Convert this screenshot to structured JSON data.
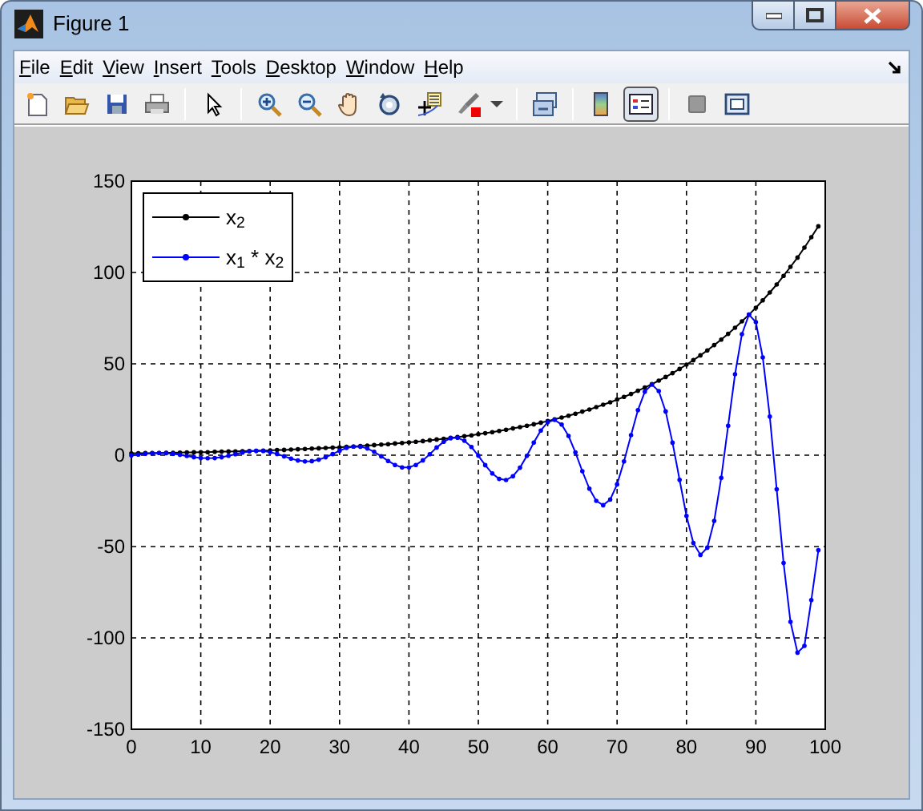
{
  "window": {
    "title": "Figure 1"
  },
  "menu": [
    {
      "label": "File"
    },
    {
      "label": "Edit"
    },
    {
      "label": "View"
    },
    {
      "label": "Insert"
    },
    {
      "label": "Tools"
    },
    {
      "label": "Desktop"
    },
    {
      "label": "Window"
    },
    {
      "label": "Help"
    }
  ],
  "toolbar": [
    {
      "kind": "new",
      "pressed": false
    },
    {
      "kind": "open",
      "pressed": false
    },
    {
      "kind": "save",
      "pressed": false
    },
    {
      "kind": "print",
      "pressed": false
    },
    {
      "kind": "separator"
    },
    {
      "kind": "pointer",
      "pressed": false
    },
    {
      "kind": "separator"
    },
    {
      "kind": "zoom-in",
      "pressed": false
    },
    {
      "kind": "zoom-out",
      "pressed": false
    },
    {
      "kind": "pan",
      "pressed": false
    },
    {
      "kind": "rotate",
      "pressed": false
    },
    {
      "kind": "data-cursor",
      "pressed": false
    },
    {
      "kind": "brush",
      "pressed": false
    },
    {
      "kind": "dropdown"
    },
    {
      "kind": "separator"
    },
    {
      "kind": "link",
      "pressed": false
    },
    {
      "kind": "separator"
    },
    {
      "kind": "colorbar",
      "pressed": false
    },
    {
      "kind": "legend",
      "pressed": true
    },
    {
      "kind": "separator"
    },
    {
      "kind": "hide-tools",
      "pressed": false
    },
    {
      "kind": "show-tools",
      "pressed": false
    }
  ],
  "chart_data": {
    "type": "line",
    "grid": true,
    "xlim": [
      0,
      100
    ],
    "ylim": [
      -150,
      150
    ],
    "xticks": [
      0,
      10,
      20,
      30,
      40,
      50,
      60,
      70,
      80,
      90,
      100
    ],
    "yticks": [
      -150,
      -100,
      -50,
      0,
      50,
      100,
      150
    ],
    "x": [
      0,
      1,
      2,
      3,
      4,
      5,
      6,
      7,
      8,
      9,
      10,
      11,
      12,
      13,
      14,
      15,
      16,
      17,
      18,
      19,
      20,
      21,
      22,
      23,
      24,
      25,
      26,
      27,
      28,
      29,
      30,
      31,
      32,
      33,
      34,
      35,
      36,
      37,
      38,
      39,
      40,
      41,
      42,
      43,
      44,
      45,
      46,
      47,
      48,
      49,
      50,
      51,
      52,
      53,
      54,
      55,
      56,
      57,
      58,
      59,
      60,
      61,
      62,
      63,
      64,
      65,
      66,
      67,
      68,
      69,
      70,
      71,
      72,
      73,
      74,
      75,
      76,
      77,
      78,
      79,
      80,
      81,
      82,
      83,
      84,
      85,
      86,
      87,
      88,
      89,
      90,
      91,
      92,
      93,
      94,
      95,
      96,
      97,
      98,
      99
    ],
    "series": [
      {
        "name": "x$_{2}$",
        "color": "#000000",
        "values": [
          1.0,
          1.05,
          1.1,
          1.16,
          1.22,
          1.28,
          1.34,
          1.41,
          1.48,
          1.55,
          1.63,
          1.71,
          1.8,
          1.89,
          1.98,
          2.08,
          2.18,
          2.29,
          2.41,
          2.53,
          2.65,
          2.79,
          2.93,
          3.07,
          3.23,
          3.39,
          3.56,
          3.73,
          3.92,
          4.12,
          4.32,
          4.54,
          4.76,
          5.0,
          5.25,
          5.52,
          5.79,
          6.08,
          6.39,
          6.7,
          7.04,
          7.39,
          7.76,
          8.15,
          8.56,
          8.99,
          9.43,
          9.91,
          10.4,
          10.92,
          11.47,
          12.04,
          12.64,
          13.27,
          13.94,
          14.64,
          15.37,
          16.14,
          16.94,
          17.79,
          18.68,
          19.61,
          20.59,
          21.62,
          22.7,
          23.84,
          25.03,
          26.28,
          27.6,
          28.98,
          30.43,
          31.95,
          33.55,
          35.22,
          36.98,
          38.83,
          40.78,
          42.81,
          44.95,
          47.2,
          49.56,
          52.04,
          54.64,
          57.37,
          60.24,
          63.25,
          66.42,
          69.74,
          73.23,
          76.89,
          80.73,
          84.77,
          89.01,
          93.46,
          98.13,
          103.04,
          108.19,
          113.6,
          119.28,
          125.24
        ]
      },
      {
        "name": "x$_{1}$ * x$_{2}$",
        "color": "#0000ff",
        "values": [
          -0.1,
          0.34,
          0.77,
          1.09,
          1.22,
          1.1,
          0.75,
          0.22,
          -0.42,
          -1.04,
          -1.5,
          -1.71,
          -1.59,
          -1.13,
          -0.39,
          0.5,
          1.38,
          2.07,
          2.41,
          2.28,
          1.67,
          0.67,
          -0.58,
          -1.85,
          -2.86,
          -3.39,
          -3.28,
          -2.48,
          -1.11,
          0.64,
          2.43,
          3.92,
          4.74,
          4.69,
          3.67,
          1.8,
          -0.65,
          -3.2,
          -5.37,
          -6.64,
          -6.69,
          -5.38,
          -2.84,
          0.55,
          4.18,
          7.33,
          9.29,
          9.56,
          7.89,
          4.43,
          -0.27,
          -5.42,
          -9.97,
          -12.95,
          -13.59,
          -11.49,
          -6.86,
          -0.32,
          6.95,
          13.54,
          18.03,
          19.3,
          16.74,
          10.49,
          1.45,
          -8.8,
          -18.3,
          -25.04,
          -27.35,
          -24.31,
          -15.98,
          -3.45,
          11.0,
          24.69,
          34.72,
          38.67,
          35.11,
          23.97,
          6.83,
          -13.5,
          -33.26,
          -48.03,
          -54.59,
          -50.6,
          -35.96,
          -12.33,
          16.14,
          44.28,
          66.27,
          76.89,
          72.82,
          53.49,
          21.18,
          -18.69,
          -59.07,
          -91.19,
          -108.08,
          -104.4,
          -79.32,
          -52.0
        ]
      }
    ]
  }
}
